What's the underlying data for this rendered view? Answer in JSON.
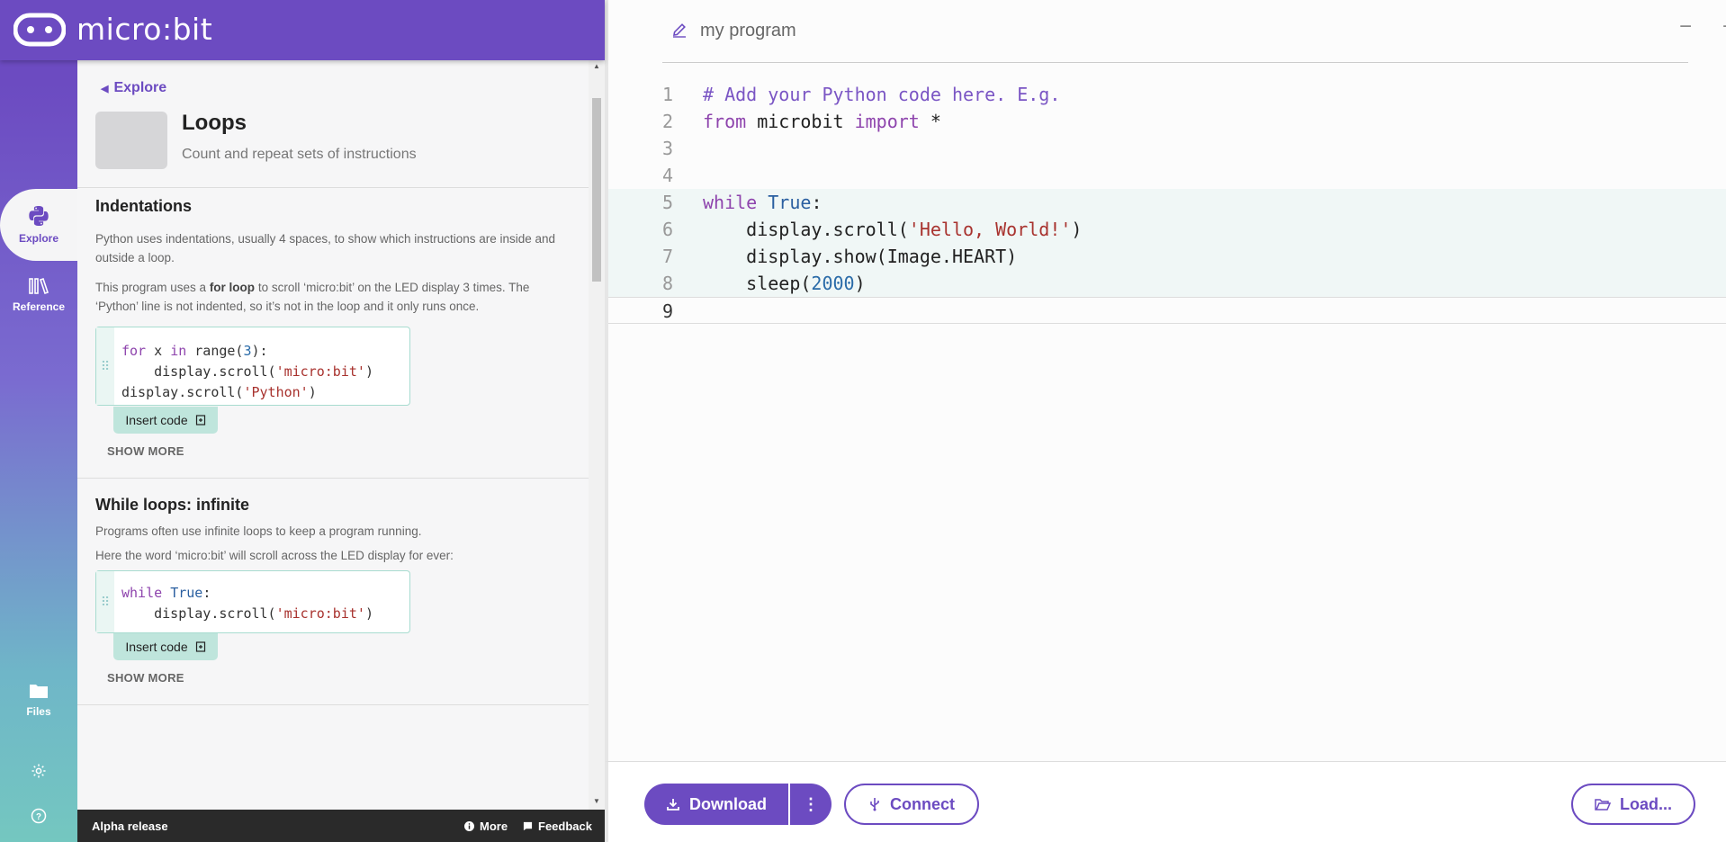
{
  "app": {
    "brand": "micro:bit"
  },
  "nav": {
    "explore": "Explore",
    "reference": "Reference",
    "files": "Files"
  },
  "panel": {
    "breadcrumb": "Explore",
    "topic_title": "Loops",
    "topic_subtitle": "Count and repeat sets of instructions",
    "sections": [
      {
        "title": "Indentations",
        "para1": "Python uses indentations, usually 4 spaces, to show which instructions are inside and outside a loop.",
        "para2_pre": "This program uses a ",
        "para2_bold": "for loop",
        "para2_post": " to scroll ‘micro:bit’ on the LED display 3 times. The ‘Python’ line is not indented, so it’s not in the loop and it only runs once.",
        "insert": "Insert code",
        "show_more": "SHOW MORE"
      },
      {
        "title": "While loops: infinite",
        "para1": "Programs often use infinite loops to keep a program running.",
        "para2": "Here the word ‘micro:bit’ will scroll across the LED display for ever:",
        "insert": "Insert code",
        "show_more": "SHOW MORE"
      }
    ]
  },
  "footer": {
    "alpha": "Alpha release",
    "more": "More",
    "feedback": "Feedback"
  },
  "editor": {
    "program_name": "my program",
    "zoom_out": "−",
    "zoom_in": "+",
    "line_numbers": [
      "1",
      "2",
      "3",
      "4",
      "5",
      "6",
      "7",
      "8",
      "9"
    ]
  },
  "toolbar": {
    "download": "Download",
    "connect": "Connect",
    "load": "Load..."
  },
  "colors": {
    "brand": "#6c4bc1",
    "teal": "#74c7c0"
  }
}
